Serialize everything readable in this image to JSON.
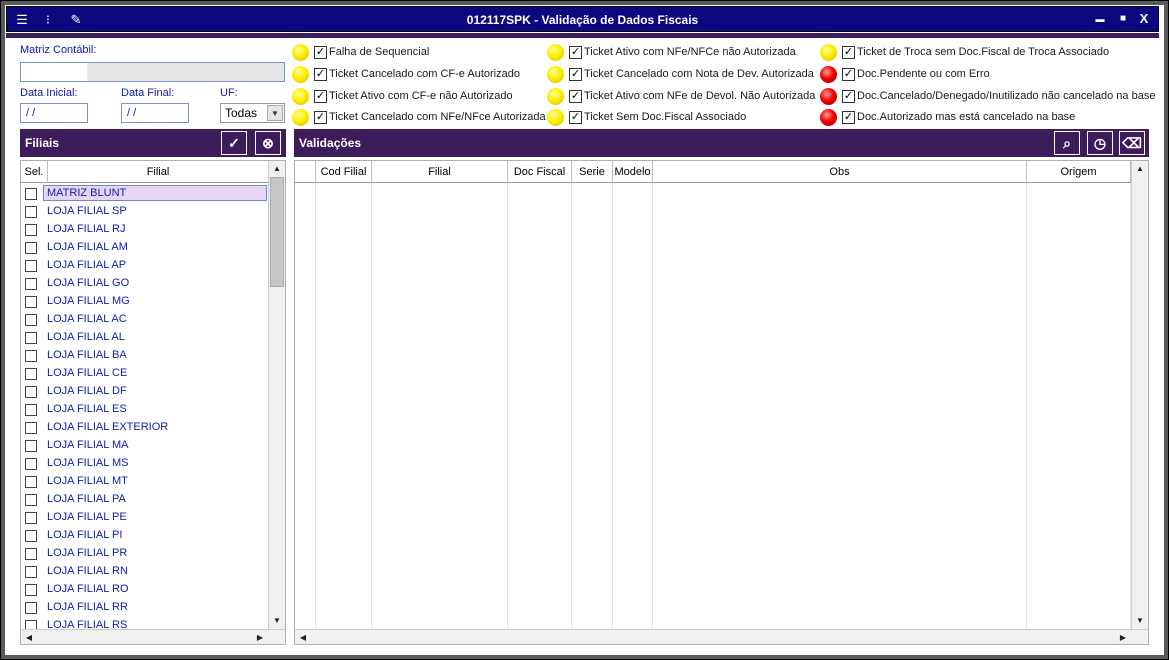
{
  "window": {
    "title": "012117SPK - Validação de Dados Fiscais",
    "controls": {
      "minimize": "▬",
      "maximize": "■",
      "close": "X"
    }
  },
  "filters": {
    "matriz_label": "Matriz Contábil:",
    "matriz_value": "",
    "data_inicial_label": "Data Inicial:",
    "data_inicial_value": " / /",
    "data_final_label": "Data Final:",
    "data_final_value": " / /",
    "uf_label": "UF:",
    "uf_value": "Todas"
  },
  "legend": [
    {
      "color": "yellow",
      "checked": true,
      "label": "Falha de Sequencial"
    },
    {
      "color": "yellow",
      "checked": true,
      "label": "Ticket Cancelado com CF-e Autorizado"
    },
    {
      "color": "yellow",
      "checked": true,
      "label": "Ticket Ativo com CF-e não Autorizado"
    },
    {
      "color": "yellow",
      "checked": true,
      "label": "Ticket Cancelado com NFe/NFce Autorizada"
    },
    {
      "color": "yellow",
      "checked": true,
      "label": "Ticket Ativo com NFe/NFCe não Autorizada"
    },
    {
      "color": "yellow",
      "checked": true,
      "label": "Ticket Cancelado com Nota de Dev. Autorizada"
    },
    {
      "color": "yellow",
      "checked": true,
      "label": "Ticket Ativo com NFe de Devol. Não Autorizada"
    },
    {
      "color": "yellow",
      "checked": true,
      "label": "Ticket Sem Doc.Fiscal Associado"
    },
    {
      "color": "yellow",
      "checked": true,
      "label": "Ticket de Troca sem Doc.Fiscal de Troca Associado"
    },
    {
      "color": "red",
      "checked": true,
      "label": "Doc.Pendente ou com Erro"
    },
    {
      "color": "red",
      "checked": true,
      "label": "Doc.Cancelado/Denegado/Inutilizado não cancelado na base"
    },
    {
      "color": "red",
      "checked": true,
      "label": "Doc.Autorizado mas está cancelado na base"
    }
  ],
  "filiais": {
    "title": "Filiais",
    "columns": {
      "sel": "Sel.",
      "filial": "Filial"
    },
    "rows": [
      "MATRIZ BLUNT",
      "LOJA FILIAL SP",
      "LOJA FILIAL RJ",
      "LOJA FILIAL AM",
      "LOJA FILIAL AP",
      "LOJA FILIAL GO",
      "LOJA FILIAL MG",
      "LOJA FILIAL AC",
      "LOJA FILIAL AL",
      "LOJA FILIAL BA",
      "LOJA FILIAL CE",
      "LOJA FILIAL DF",
      "LOJA FILIAL ES",
      "LOJA FILIAL EXTERIOR",
      "LOJA FILIAL MA",
      "LOJA FILIAL MS",
      "LOJA FILIAL MT",
      "LOJA FILIAL PA",
      "LOJA FILIAL PE",
      "LOJA FILIAL PI",
      "LOJA FILIAL PR",
      "LOJA FILIAL RN",
      "LOJA FILIAL RO",
      "LOJA FILIAL RR",
      "LOJA FILIAL RS"
    ]
  },
  "validacoes": {
    "title": "Validações",
    "columns": [
      "",
      "Cod Filial",
      "Filial",
      "Doc Fiscal",
      "Serie",
      "Modelo",
      "Obs",
      "Origem"
    ]
  },
  "icons": {
    "toolbar": [
      "list-icon",
      "traffic-light-icon",
      "wrench-icon"
    ],
    "filiais_buttons": [
      "select-all-icon",
      "deselect-all-icon"
    ],
    "validacoes_buttons": [
      "search-icon",
      "clock-icon",
      "eraser-icon"
    ]
  }
}
